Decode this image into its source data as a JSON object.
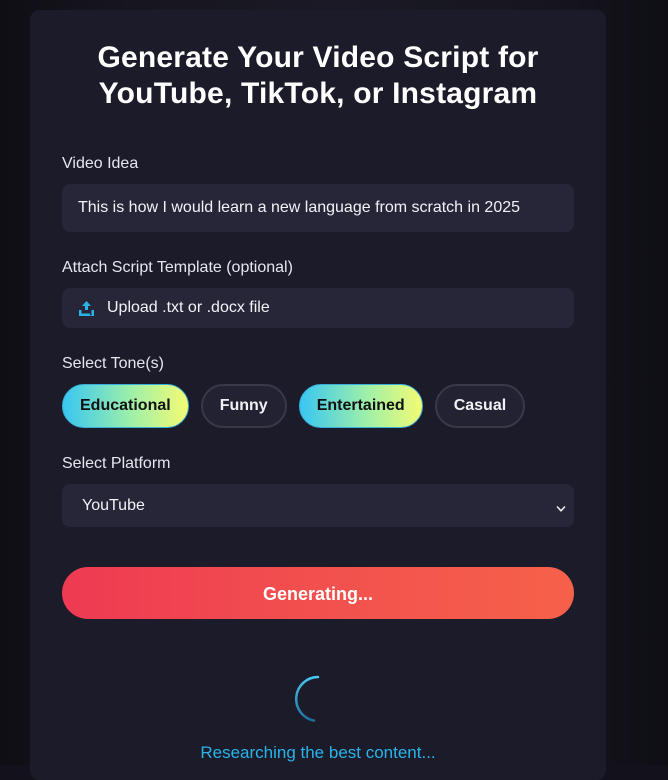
{
  "header": {
    "title_line1": "Generate Your Video Script for",
    "title_line2": "YouTube, TikTok, or Instagram"
  },
  "video_idea": {
    "label": "Video Idea",
    "value": "This is how I would learn a new language from scratch in 2025"
  },
  "template": {
    "label": "Attach Script Template (optional)",
    "upload_text": "Upload .txt or .docx file",
    "icon": "upload-icon"
  },
  "tone": {
    "label": "Select Tone(s)",
    "options": [
      {
        "label": "Educational",
        "selected": true
      },
      {
        "label": "Funny",
        "selected": false
      },
      {
        "label": "Entertained",
        "selected": true
      },
      {
        "label": "Casual",
        "selected": false
      }
    ]
  },
  "platform": {
    "label": "Select Platform",
    "selected": "YouTube",
    "icon": "chevron-down-icon"
  },
  "generate_button": {
    "label": "Generating..."
  },
  "status": {
    "message": "Researching the best content..."
  },
  "colors": {
    "accent_cyan": "#28b4ea",
    "button_red": "#ee3a52",
    "button_orange": "#f6614a",
    "tone_gradient_start": "#38c6f2",
    "tone_gradient_end": "#f3fb73"
  }
}
